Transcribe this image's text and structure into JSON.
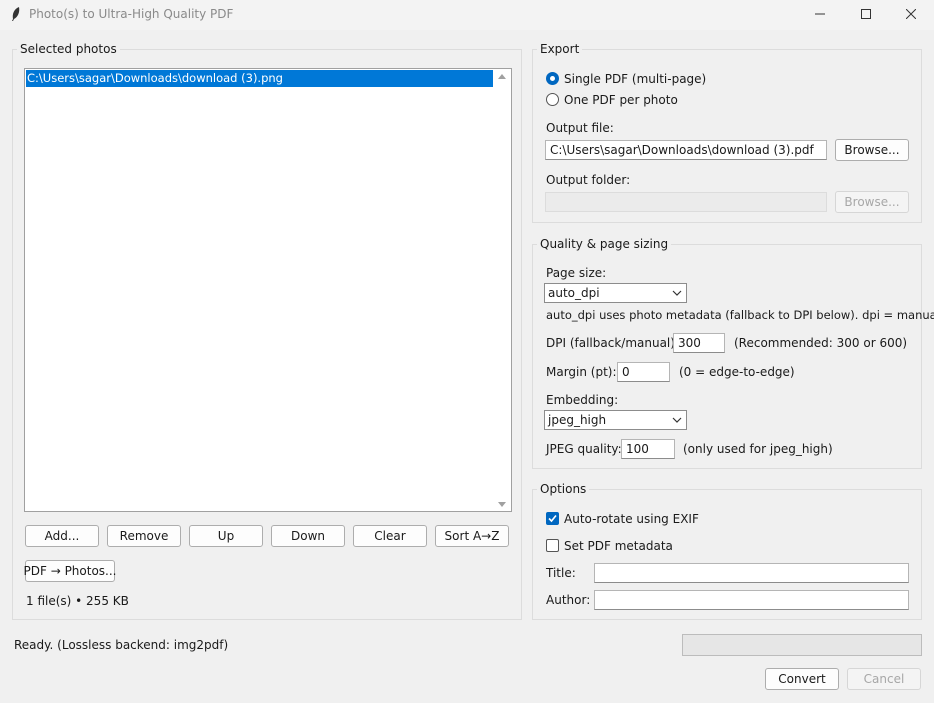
{
  "window": {
    "title": "Photo(s) to Ultra-High Quality PDF",
    "icons": [
      "feather-icon",
      "minimize-icon",
      "maximize-icon",
      "close-icon"
    ]
  },
  "photos": {
    "label": "Selected photos",
    "files": [
      "C:\\Users\\sagar\\Downloads\\download (3).png"
    ],
    "buttons": {
      "add": "Add...",
      "remove": "Remove",
      "up": "Up",
      "down": "Down",
      "clear": "Clear",
      "sort": "Sort A→Z",
      "pdf_to_photos": "PDF → Photos..."
    },
    "summary": "1 file(s) • 255 KB"
  },
  "export": {
    "label": "Export",
    "mode_single": "Single PDF (multi-page)",
    "mode_per_photo": "One PDF per photo",
    "selected_mode": "single",
    "output_file_label": "Output file:",
    "output_file_value": "C:\\Users\\sagar\\Downloads\\download (3).pdf",
    "browse_file": "Browse...",
    "output_folder_label": "Output folder:",
    "output_folder_value": "",
    "browse_folder": "Browse..."
  },
  "quality": {
    "label": "Quality & page sizing",
    "page_size_label": "Page size:",
    "page_size_value": "auto_dpi",
    "page_size_hint": "auto_dpi uses photo metadata (fallback to DPI below). dpi = manual.",
    "dpi_label": "DPI (fallback/manual):",
    "dpi_value": "300",
    "dpi_hint": "(Recommended: 300 or 600)",
    "margin_label": "Margin (pt):",
    "margin_value": "0",
    "margin_hint": "(0 = edge-to-edge)",
    "embedding_label": "Embedding:",
    "embedding_value": "jpeg_high",
    "jpeg_label": "JPEG quality:",
    "jpeg_value": "100",
    "jpeg_hint": "(only used for jpeg_high)"
  },
  "options": {
    "label": "Options",
    "autorotate_label": "Auto-rotate using EXIF",
    "autorotate_checked": true,
    "metadata_label": "Set PDF metadata",
    "metadata_checked": false,
    "title_label": "Title:",
    "title_value": "",
    "author_label": "Author:",
    "author_value": ""
  },
  "status": {
    "text": "Ready. (Lossless backend: img2pdf)",
    "progress": 0
  },
  "actions": {
    "convert": "Convert",
    "cancel": "Cancel"
  },
  "colors": {
    "selection": "#0078d7",
    "accent": "#0067c0",
    "window_bg": "#f0f0f0"
  }
}
